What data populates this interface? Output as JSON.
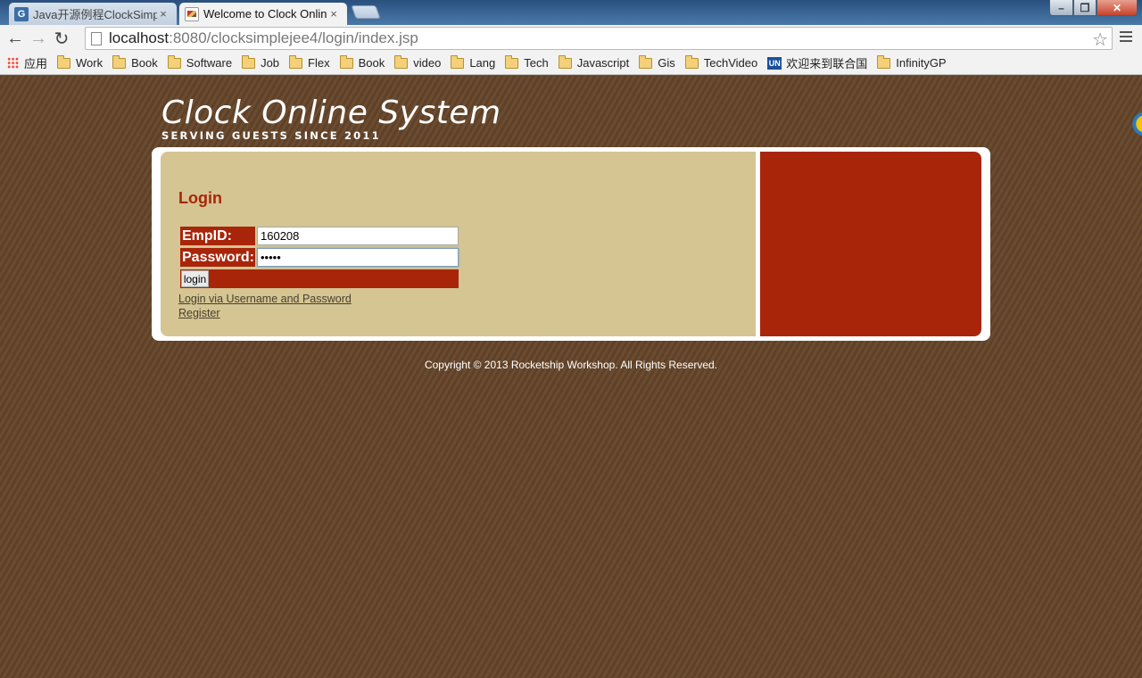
{
  "browser": {
    "tabs": [
      {
        "title": "Java开源例程ClockSimpl",
        "favicon": "G"
      },
      {
        "title": "Welcome to Clock Onlin"
      }
    ],
    "tab_close_glyph": "×",
    "address": {
      "host": "localhost",
      "rest": ":8080/clocksimplejee4/login/index.jsp"
    },
    "icons": {
      "back": "←",
      "forward": "→",
      "reload": "↻",
      "star": "☆"
    },
    "window_controls": {
      "min": "–",
      "max": "❐",
      "close": "✕"
    },
    "bookmarks": [
      {
        "label": "应用",
        "icon": "apps-grid-icon"
      },
      {
        "label": "Work",
        "icon": "folder-icon"
      },
      {
        "label": "Book",
        "icon": "folder-icon"
      },
      {
        "label": "Software",
        "icon": "folder-icon"
      },
      {
        "label": "Job",
        "icon": "folder-icon"
      },
      {
        "label": "Flex",
        "icon": "folder-icon"
      },
      {
        "label": "Book",
        "icon": "folder-icon"
      },
      {
        "label": "video",
        "icon": "folder-icon"
      },
      {
        "label": "Lang",
        "icon": "folder-icon"
      },
      {
        "label": "Tech",
        "icon": "folder-icon"
      },
      {
        "label": "Javascript",
        "icon": "folder-icon"
      },
      {
        "label": "Gis",
        "icon": "folder-icon"
      },
      {
        "label": "TechVideo",
        "icon": "folder-icon"
      },
      {
        "label": "欢迎来到联合国",
        "icon": "un-logo-icon",
        "logo_text": "UN"
      },
      {
        "label": "InfinityGP",
        "icon": "folder-icon"
      }
    ]
  },
  "site": {
    "title": "Clock Online System",
    "tagline": "SERVING GUESTS SINCE 2011",
    "colors": {
      "accent": "#a9250a",
      "panel": "#d4c592",
      "background": "#6a4b2f"
    }
  },
  "login": {
    "heading": "Login",
    "empid_label": "EmpID:",
    "empid_value": "160208",
    "password_label": "Password:",
    "password_value": "•••••",
    "submit_label": "login",
    "alt_link": "Login via Username and Password",
    "register_link": "Register"
  },
  "footer": {
    "copyright": "Copyright © 2013 Rocketship Workshop. All Rights Reserved."
  }
}
